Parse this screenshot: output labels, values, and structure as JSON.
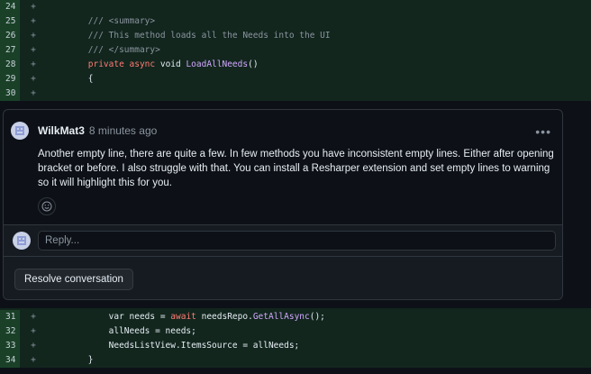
{
  "top_lines": [
    {
      "num": "24",
      "sign": "+",
      "tokens": []
    },
    {
      "num": "25",
      "sign": "+",
      "tokens": [
        {
          "t": "        /// <summary>",
          "c": "tok-comment"
        }
      ]
    },
    {
      "num": "26",
      "sign": "+",
      "tokens": [
        {
          "t": "        /// This method loads all the Needs into the UI",
          "c": "tok-comment"
        }
      ]
    },
    {
      "num": "27",
      "sign": "+",
      "tokens": [
        {
          "t": "        /// </summary>",
          "c": "tok-comment"
        }
      ]
    },
    {
      "num": "28",
      "sign": "+",
      "tokens": [
        {
          "t": "        private async ",
          "c": "tok-kw"
        },
        {
          "t": "void ",
          "c": "tok-plain"
        },
        {
          "t": "LoadAllNeeds",
          "c": "tok-fn"
        },
        {
          "t": "()",
          "c": "tok-plain"
        }
      ]
    },
    {
      "num": "29",
      "sign": "+",
      "tokens": [
        {
          "t": "        {",
          "c": "tok-plain"
        }
      ]
    },
    {
      "num": "30",
      "sign": "+",
      "tokens": []
    }
  ],
  "comment": {
    "author": "WilkMat3",
    "time": "8 minutes ago",
    "body": "Another empty line, there are quite a few. In few methods you have inconsistent empty lines. Either after opening bracket or before. I also struggle with that. You can install a Resharper extension and set empty lines to warning so it will highlight this for you.",
    "menu_icon": "kebab-horizontal-icon",
    "reaction_icon": "smiley-icon"
  },
  "reply": {
    "placeholder": "Reply..."
  },
  "resolve": {
    "label": "Resolve conversation"
  },
  "bottom_lines": [
    {
      "num": "31",
      "sign": "+",
      "tokens": [
        {
          "t": "            var needs = ",
          "c": "tok-plain"
        },
        {
          "t": "await ",
          "c": "tok-kw"
        },
        {
          "t": "needsRepo.",
          "c": "tok-plain"
        },
        {
          "t": "GetAllAsync",
          "c": "tok-fn"
        },
        {
          "t": "();",
          "c": "tok-plain"
        }
      ]
    },
    {
      "num": "32",
      "sign": "+",
      "tokens": [
        {
          "t": "            allNeeds = needs;",
          "c": "tok-plain"
        }
      ]
    },
    {
      "num": "33",
      "sign": "+",
      "tokens": [
        {
          "t": "            NeedsListView.ItemsSource = allNeeds;",
          "c": "tok-plain"
        }
      ]
    },
    {
      "num": "34",
      "sign": "+",
      "tokens": [
        {
          "t": "        }",
          "c": "tok-plain"
        }
      ]
    }
  ],
  "colors": {
    "added_bg": "#12261e",
    "added_gutter": "#1a4128",
    "keyword": "#ff7b72",
    "function": "#d2a8ff",
    "comment": "#8b949e"
  }
}
